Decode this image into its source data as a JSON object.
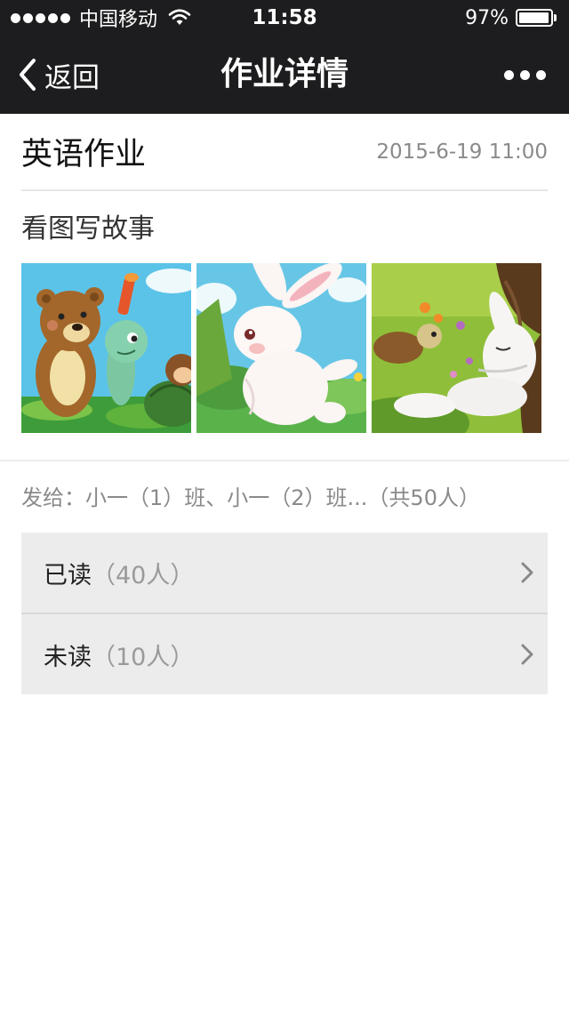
{
  "status_bar": {
    "carrier": "中国移动",
    "time": "11:58",
    "battery": "97%",
    "signal_icon": "signal-dots-icon",
    "wifi_icon": "wifi-icon",
    "battery_icon": "battery-icon",
    "battery_level": 0.97
  },
  "nav": {
    "back_label": "返回",
    "back_icon": "chevron-left-icon",
    "title": "作业详情",
    "more_icon": "more-dots-icon"
  },
  "homework": {
    "title": "英语作业",
    "timestamp": "2015-6-19 11:00",
    "description": "看图写故事",
    "images": [
      "bear-and-turtle-picture",
      "rabbit-running-picture",
      "rabbit-sleeping-picture"
    ]
  },
  "recipients": {
    "text": "发给：小一（1）班、小一（2）班...（共50人）"
  },
  "read_status": [
    {
      "label": "已读",
      "count": "（40人）",
      "icon": "chevron-right-icon"
    },
    {
      "label": "未读",
      "count": "（10人）",
      "icon": "chevron-right-icon"
    }
  ],
  "colors": {
    "bar_background": "#1d1d1f",
    "row_background": "#ececec",
    "secondary_text": "#8a8a8a"
  }
}
